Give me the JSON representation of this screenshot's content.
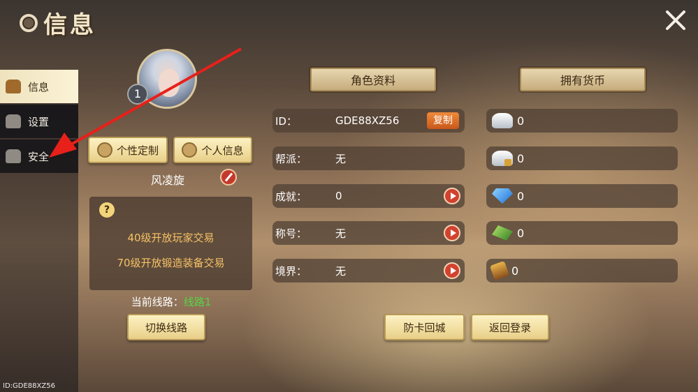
{
  "window": {
    "title": "信息",
    "close_icon": "close-icon",
    "footer_id": "ID:GDE88XZ56"
  },
  "sidebar": {
    "items": [
      {
        "label": "信息",
        "icon": "person-icon",
        "active": true
      },
      {
        "label": "设置",
        "icon": "hammer-icon",
        "active": false
      },
      {
        "label": "安全",
        "icon": "users-icon",
        "active": false
      }
    ]
  },
  "profile": {
    "level": "1",
    "buttons": {
      "customize": "个性定制",
      "personal": "个人信息"
    },
    "name": "风凌旋",
    "tips": [
      "40级开放玩家交易",
      "70级开放锻造装备交易"
    ],
    "line_label": "当前线路：",
    "line_value": "线路1",
    "switch_label": "切换线路"
  },
  "role": {
    "header": "角色资料",
    "rows": [
      {
        "key": "ID：",
        "value": "GDE88XZ56",
        "action": "复制"
      },
      {
        "key": "帮派：",
        "value": "无"
      },
      {
        "key": "成就：",
        "value": "0"
      },
      {
        "key": "称号：",
        "value": "无"
      },
      {
        "key": "境界：",
        "value": "无"
      }
    ]
  },
  "currency": {
    "header": "拥有货币",
    "items": [
      {
        "icon": "silver-ingot-icon",
        "value": "0"
      },
      {
        "icon": "bound-silver-icon",
        "value": "0"
      },
      {
        "icon": "diamond-icon",
        "value": "0"
      },
      {
        "icon": "jade-icon",
        "value": "0"
      },
      {
        "icon": "scroll-icon",
        "value": "0"
      }
    ]
  },
  "actions": {
    "return_city": "防卡回城",
    "logout": "返回登录"
  },
  "colors": {
    "gold_button": "#e8cf88",
    "line_green": "#58d347",
    "tip_orange": "#f7c266",
    "arrow_red": "#e8201a"
  }
}
